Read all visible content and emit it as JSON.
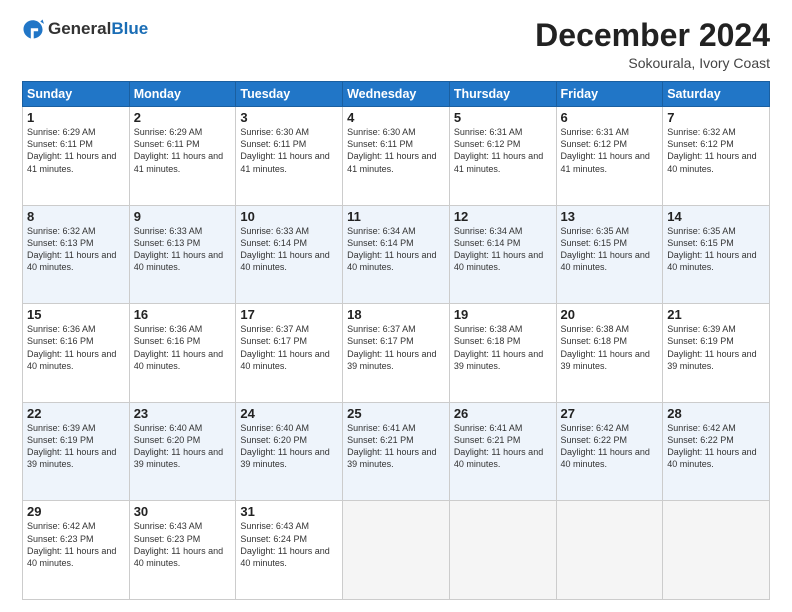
{
  "header": {
    "logo_general": "General",
    "logo_blue": "Blue",
    "month": "December 2024",
    "location": "Sokourala, Ivory Coast"
  },
  "days_of_week": [
    "Sunday",
    "Monday",
    "Tuesday",
    "Wednesday",
    "Thursday",
    "Friday",
    "Saturday"
  ],
  "weeks": [
    [
      {
        "day": "1",
        "sunrise": "6:29 AM",
        "sunset": "6:11 PM",
        "daylight": "11 hours and 41 minutes."
      },
      {
        "day": "2",
        "sunrise": "6:29 AM",
        "sunset": "6:11 PM",
        "daylight": "11 hours and 41 minutes."
      },
      {
        "day": "3",
        "sunrise": "6:30 AM",
        "sunset": "6:11 PM",
        "daylight": "11 hours and 41 minutes."
      },
      {
        "day": "4",
        "sunrise": "6:30 AM",
        "sunset": "6:11 PM",
        "daylight": "11 hours and 41 minutes."
      },
      {
        "day": "5",
        "sunrise": "6:31 AM",
        "sunset": "6:12 PM",
        "daylight": "11 hours and 41 minutes."
      },
      {
        "day": "6",
        "sunrise": "6:31 AM",
        "sunset": "6:12 PM",
        "daylight": "11 hours and 41 minutes."
      },
      {
        "day": "7",
        "sunrise": "6:32 AM",
        "sunset": "6:12 PM",
        "daylight": "11 hours and 40 minutes."
      }
    ],
    [
      {
        "day": "8",
        "sunrise": "6:32 AM",
        "sunset": "6:13 PM",
        "daylight": "11 hours and 40 minutes."
      },
      {
        "day": "9",
        "sunrise": "6:33 AM",
        "sunset": "6:13 PM",
        "daylight": "11 hours and 40 minutes."
      },
      {
        "day": "10",
        "sunrise": "6:33 AM",
        "sunset": "6:14 PM",
        "daylight": "11 hours and 40 minutes."
      },
      {
        "day": "11",
        "sunrise": "6:34 AM",
        "sunset": "6:14 PM",
        "daylight": "11 hours and 40 minutes."
      },
      {
        "day": "12",
        "sunrise": "6:34 AM",
        "sunset": "6:14 PM",
        "daylight": "11 hours and 40 minutes."
      },
      {
        "day": "13",
        "sunrise": "6:35 AM",
        "sunset": "6:15 PM",
        "daylight": "11 hours and 40 minutes."
      },
      {
        "day": "14",
        "sunrise": "6:35 AM",
        "sunset": "6:15 PM",
        "daylight": "11 hours and 40 minutes."
      }
    ],
    [
      {
        "day": "15",
        "sunrise": "6:36 AM",
        "sunset": "6:16 PM",
        "daylight": "11 hours and 40 minutes."
      },
      {
        "day": "16",
        "sunrise": "6:36 AM",
        "sunset": "6:16 PM",
        "daylight": "11 hours and 40 minutes."
      },
      {
        "day": "17",
        "sunrise": "6:37 AM",
        "sunset": "6:17 PM",
        "daylight": "11 hours and 40 minutes."
      },
      {
        "day": "18",
        "sunrise": "6:37 AM",
        "sunset": "6:17 PM",
        "daylight": "11 hours and 39 minutes."
      },
      {
        "day": "19",
        "sunrise": "6:38 AM",
        "sunset": "6:18 PM",
        "daylight": "11 hours and 39 minutes."
      },
      {
        "day": "20",
        "sunrise": "6:38 AM",
        "sunset": "6:18 PM",
        "daylight": "11 hours and 39 minutes."
      },
      {
        "day": "21",
        "sunrise": "6:39 AM",
        "sunset": "6:19 PM",
        "daylight": "11 hours and 39 minutes."
      }
    ],
    [
      {
        "day": "22",
        "sunrise": "6:39 AM",
        "sunset": "6:19 PM",
        "daylight": "11 hours and 39 minutes."
      },
      {
        "day": "23",
        "sunrise": "6:40 AM",
        "sunset": "6:20 PM",
        "daylight": "11 hours and 39 minutes."
      },
      {
        "day": "24",
        "sunrise": "6:40 AM",
        "sunset": "6:20 PM",
        "daylight": "11 hours and 39 minutes."
      },
      {
        "day": "25",
        "sunrise": "6:41 AM",
        "sunset": "6:21 PM",
        "daylight": "11 hours and 39 minutes."
      },
      {
        "day": "26",
        "sunrise": "6:41 AM",
        "sunset": "6:21 PM",
        "daylight": "11 hours and 40 minutes."
      },
      {
        "day": "27",
        "sunrise": "6:42 AM",
        "sunset": "6:22 PM",
        "daylight": "11 hours and 40 minutes."
      },
      {
        "day": "28",
        "sunrise": "6:42 AM",
        "sunset": "6:22 PM",
        "daylight": "11 hours and 40 minutes."
      }
    ],
    [
      {
        "day": "29",
        "sunrise": "6:42 AM",
        "sunset": "6:23 PM",
        "daylight": "11 hours and 40 minutes."
      },
      {
        "day": "30",
        "sunrise": "6:43 AM",
        "sunset": "6:23 PM",
        "daylight": "11 hours and 40 minutes."
      },
      {
        "day": "31",
        "sunrise": "6:43 AM",
        "sunset": "6:24 PM",
        "daylight": "11 hours and 40 minutes."
      },
      null,
      null,
      null,
      null
    ]
  ]
}
